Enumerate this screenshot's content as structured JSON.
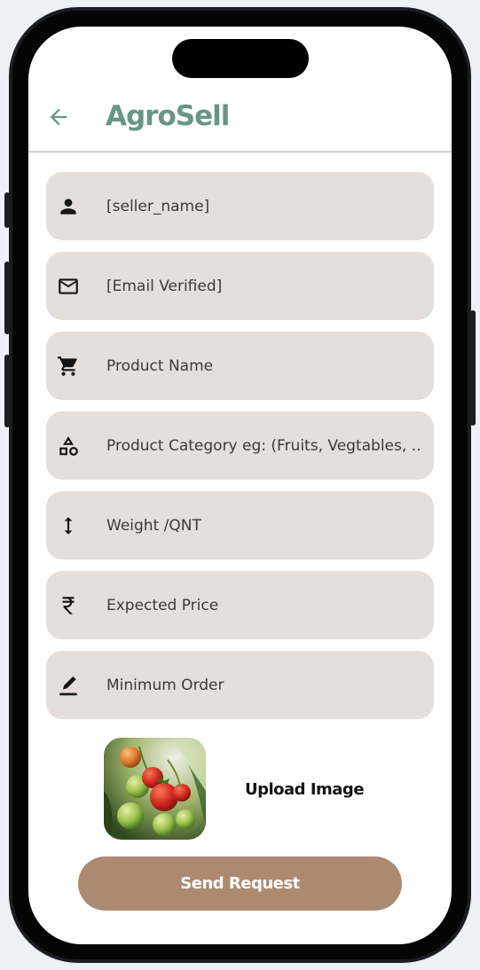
{
  "app": {
    "title": "AgroSell",
    "back_icon": "arrow-left-icon",
    "title_color": "#679684"
  },
  "form": {
    "fields": [
      {
        "icon": "person-icon",
        "value": "",
        "placeholder": "[seller_name]"
      },
      {
        "icon": "mail-icon",
        "value": "",
        "placeholder": "[Email Verified]"
      },
      {
        "icon": "cart-icon",
        "value": "",
        "placeholder": "Product Name"
      },
      {
        "icon": "category-shapes-icon",
        "value": "",
        "placeholder": "Product Category eg: (Fruits, Vegtables, ..."
      },
      {
        "icon": "vertical-arrows-icon",
        "value": "",
        "placeholder": "Weight /QNT"
      },
      {
        "icon": "rupee-icon",
        "value": "",
        "placeholder": "Expected Price"
      },
      {
        "icon": "edit-pen-icon",
        "value": "",
        "placeholder": "Minimum Order"
      }
    ],
    "field_bg_color": "#e4dfda"
  },
  "upload": {
    "label": "Upload Image",
    "thumbnail": "tomatoes-photo"
  },
  "actions": {
    "send_label": "Send Request",
    "send_color": "#ac8a72"
  }
}
